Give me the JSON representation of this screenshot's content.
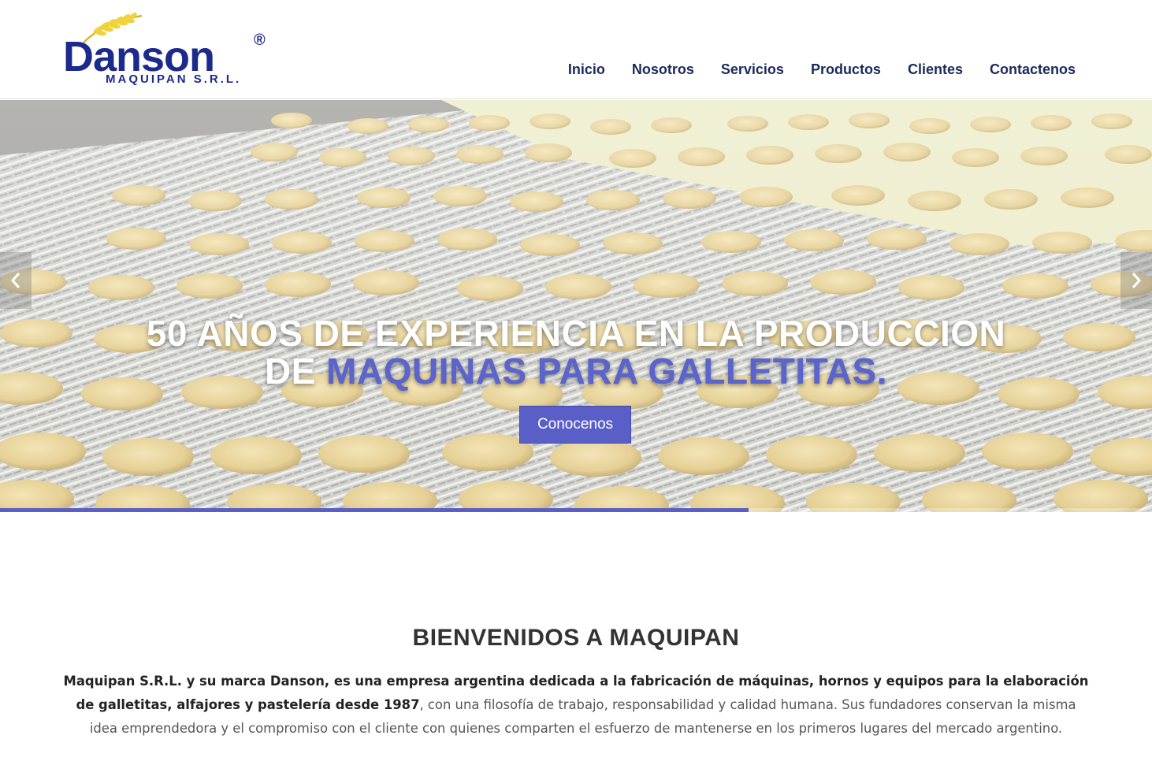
{
  "brand": {
    "name": "Danson",
    "registered": "®",
    "subtitle": "MAQUIPAN S.R.L."
  },
  "nav": {
    "items": [
      "Inicio",
      "Nosotros",
      "Servicios",
      "Productos",
      "Clientes",
      "Contactenos"
    ]
  },
  "hero": {
    "title_line1": "50 AÑOS DE EXPERIENCIA EN LA PRODUCCION",
    "title_line2_prefix": "DE ",
    "title_line2_accent": "MAQUINAS PARA GALLETITAS.",
    "cta_label": "Conocenos",
    "prev_icon": "chevron-left-icon",
    "next_icon": "chevron-right-icon",
    "slide_progress": 0.65
  },
  "welcome": {
    "title": "BIENVENIDOS A MAQUIPAN",
    "bold_text": "Maquipan S.R.L. y su marca Danson, es una empresa argentina dedicada a la fabricación de máquinas, hornos y equipos para la elaboración de galletitas, alfajores y pastelería desde 1987",
    "body_text": ", con una filosofía de trabajo, responsabilidad y calidad humana. Sus fundadores conservan la misma idea emprendedora y el compromiso con el cliente con quienes comparten el esfuerzo de mantenerse en los primeros lugares del mercado argentino."
  },
  "colors": {
    "brand_blue": "#1c2a8c",
    "accent": "#5a5fc7",
    "wheat": "#e8c832"
  }
}
